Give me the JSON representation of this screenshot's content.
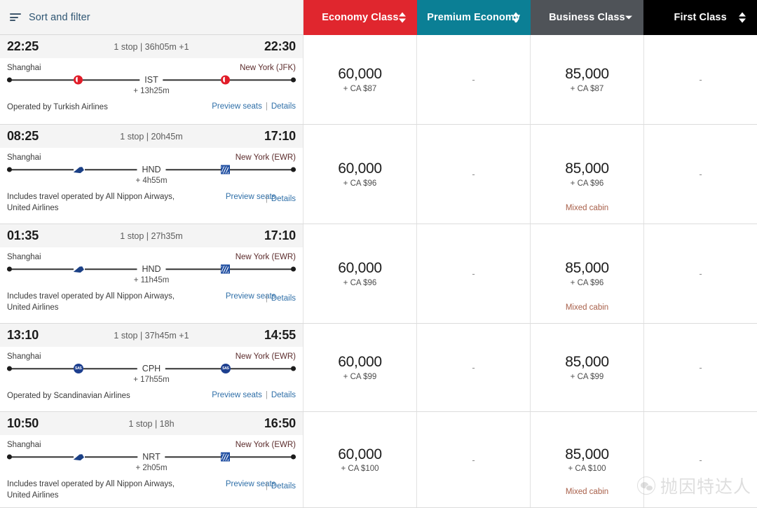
{
  "toolbar": {
    "sort_filter_label": "Sort and filter",
    "icon": "sort-filter-icon"
  },
  "columns": [
    {
      "label": "Economy Class",
      "color": "#e0262e",
      "sort_icon": "updown-arrows"
    },
    {
      "label": "Premium Economy",
      "color": "#0b7f95",
      "sort_icon": "updown-arrows"
    },
    {
      "label": "Business Class",
      "color": "#4f5358",
      "sort_icon": "down-arrow"
    },
    {
      "label": "First Class",
      "color": "#000000",
      "sort_icon": "updown-arrows"
    }
  ],
  "rows": [
    {
      "depart_time": "22:25",
      "arrive_time": "22:30",
      "summary": "1 stop | 36h05m +1",
      "origin": "Shanghai",
      "destination": "New York (JFK)",
      "connection_code": "IST",
      "layover": "+ 13h25m",
      "carrier_logo": "turkish-airlines-logo",
      "operated_by": "Operated by Turkish Airlines",
      "preview_label": "Preview seats",
      "details_label": "Details",
      "two_line_actions": false,
      "prices": [
        {
          "miles": "60,000",
          "cash": "+ CA $87",
          "note": ""
        },
        {
          "miles": "-",
          "cash": "",
          "note": ""
        },
        {
          "miles": "85,000",
          "cash": "+ CA $87",
          "note": ""
        },
        {
          "miles": "-",
          "cash": "",
          "note": ""
        }
      ]
    },
    {
      "depart_time": "08:25",
      "arrive_time": "17:10",
      "summary": "1 stop | 20h45m",
      "origin": "Shanghai",
      "destination": "New York (EWR)",
      "connection_code": "HND",
      "layover": "+ 4h55m",
      "carrier_logo": "ana-united-logos",
      "operated_by": "Includes travel operated by All Nippon Airways, United Airlines",
      "preview_label": "Preview seats",
      "details_label": "Details",
      "two_line_actions": true,
      "prices": [
        {
          "miles": "60,000",
          "cash": "+ CA $96",
          "note": ""
        },
        {
          "miles": "-",
          "cash": "",
          "note": ""
        },
        {
          "miles": "85,000",
          "cash": "+ CA $96",
          "note": "Mixed cabin"
        },
        {
          "miles": "-",
          "cash": "",
          "note": ""
        }
      ]
    },
    {
      "depart_time": "01:35",
      "arrive_time": "17:10",
      "summary": "1 stop | 27h35m",
      "origin": "Shanghai",
      "destination": "New York (EWR)",
      "connection_code": "HND",
      "layover": "+ 11h45m",
      "carrier_logo": "ana-united-logos",
      "operated_by": "Includes travel operated by All Nippon Airways, United Airlines",
      "preview_label": "Preview seats",
      "details_label": "Details",
      "two_line_actions": true,
      "prices": [
        {
          "miles": "60,000",
          "cash": "+ CA $96",
          "note": ""
        },
        {
          "miles": "-",
          "cash": "",
          "note": ""
        },
        {
          "miles": "85,000",
          "cash": "+ CA $96",
          "note": "Mixed cabin"
        },
        {
          "miles": "-",
          "cash": "",
          "note": ""
        }
      ]
    },
    {
      "depart_time": "13:10",
      "arrive_time": "14:55",
      "summary": "1 stop | 37h45m +1",
      "origin": "Shanghai",
      "destination": "New York (EWR)",
      "connection_code": "CPH",
      "layover": "+ 17h55m",
      "carrier_logo": "sas-logo",
      "operated_by": "Operated by Scandinavian Airlines",
      "preview_label": "Preview seats",
      "details_label": "Details",
      "two_line_actions": false,
      "prices": [
        {
          "miles": "60,000",
          "cash": "+ CA $99",
          "note": ""
        },
        {
          "miles": "-",
          "cash": "",
          "note": ""
        },
        {
          "miles": "85,000",
          "cash": "+ CA $99",
          "note": ""
        },
        {
          "miles": "-",
          "cash": "",
          "note": ""
        }
      ]
    },
    {
      "depart_time": "10:50",
      "arrive_time": "16:50",
      "summary": "1 stop | 18h",
      "origin": "Shanghai",
      "destination": "New York (EWR)",
      "connection_code": "NRT",
      "layover": "+ 2h05m",
      "carrier_logo": "ana-united-logos",
      "operated_by": "Includes travel operated by All Nippon Airways, United Airlines",
      "preview_label": "Preview seats",
      "details_label": "Details",
      "two_line_actions": true,
      "prices": [
        {
          "miles": "60,000",
          "cash": "+ CA $100",
          "note": ""
        },
        {
          "miles": "-",
          "cash": "",
          "note": ""
        },
        {
          "miles": "85,000",
          "cash": "+ CA $100",
          "note": "Mixed cabin"
        },
        {
          "miles": "-",
          "cash": "",
          "note": ""
        }
      ]
    }
  ],
  "watermark": {
    "text": "抛因特达人",
    "logo": "wechat-logo"
  }
}
